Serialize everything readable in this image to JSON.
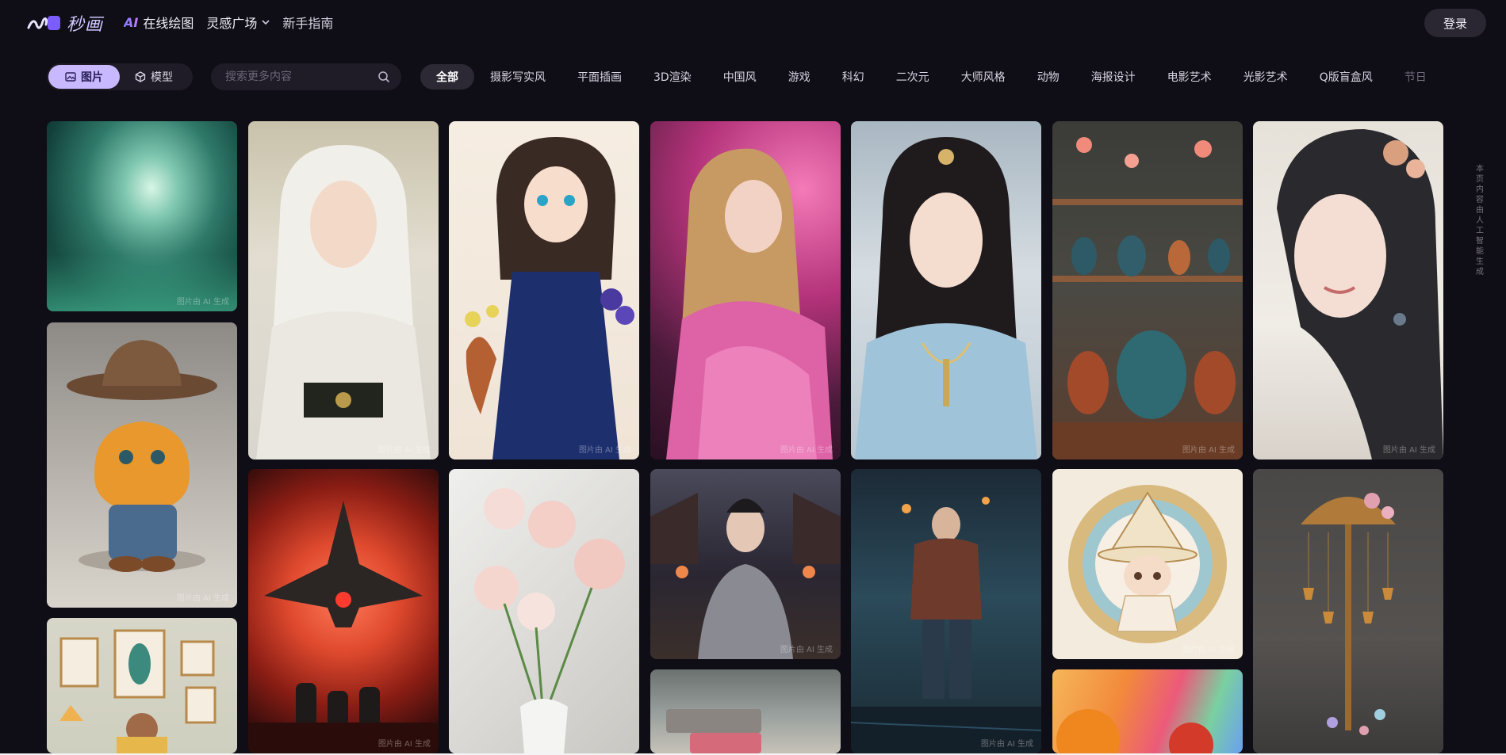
{
  "header": {
    "logo_text": "秒画",
    "nav": {
      "ai_label": "AI",
      "ai_rest": "在线绘图",
      "inspiration": "灵感广场",
      "guide": "新手指南"
    },
    "login_label": "登录"
  },
  "filters": {
    "type_tabs": [
      {
        "label": "图片",
        "icon": "image-icon"
      },
      {
        "label": "模型",
        "icon": "cube-icon"
      }
    ],
    "search_placeholder": "搜索更多内容",
    "categories": [
      "全部",
      "摄影写实风",
      "平面插画",
      "3D渲染",
      "中国风",
      "游戏",
      "科幻",
      "二次元",
      "大师风格",
      "动物",
      "海报设计",
      "电影艺术",
      "光影艺术",
      "Q版盲盒风",
      "节日"
    ]
  },
  "gallery": {
    "watermark": "图片由 AI 生成",
    "side_note": "本页内容由人工智能生成"
  }
}
